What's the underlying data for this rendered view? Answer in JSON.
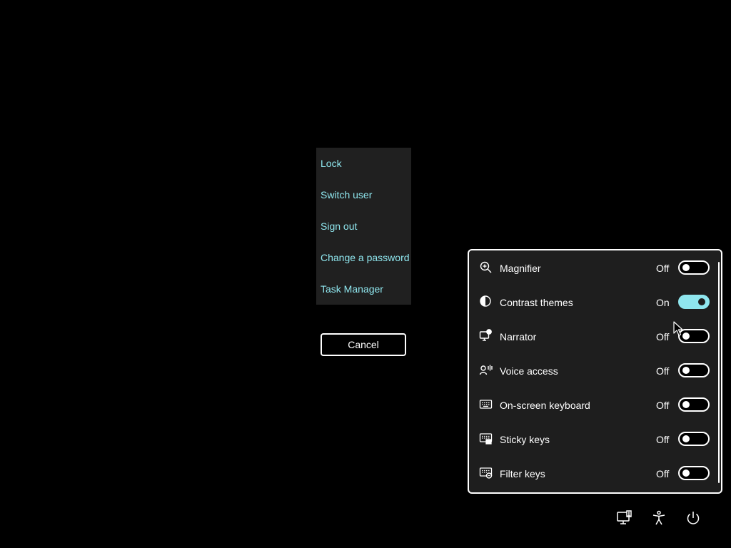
{
  "security_menu": {
    "items": [
      {
        "label": "Lock"
      },
      {
        "label": "Switch user"
      },
      {
        "label": "Sign out"
      },
      {
        "label": "Change a password"
      },
      {
        "label": "Task Manager"
      }
    ],
    "cancel_label": "Cancel"
  },
  "accessibility_panel": {
    "rows": [
      {
        "label": "Magnifier",
        "state": "Off",
        "on": false,
        "icon": "magnifier-icon"
      },
      {
        "label": "Contrast themes",
        "state": "On",
        "on": true,
        "icon": "contrast-icon"
      },
      {
        "label": "Narrator",
        "state": "Off",
        "on": false,
        "icon": "narrator-icon"
      },
      {
        "label": "Voice access",
        "state": "Off",
        "on": false,
        "icon": "voice-access-icon"
      },
      {
        "label": "On-screen keyboard",
        "state": "Off",
        "on": false,
        "icon": "keyboard-icon"
      },
      {
        "label": "Sticky keys",
        "state": "Off",
        "on": false,
        "icon": "sticky-keys-icon"
      },
      {
        "label": "Filter keys",
        "state": "Off",
        "on": false,
        "icon": "filter-keys-icon"
      }
    ]
  },
  "tray": {
    "icons": [
      "network-icon",
      "accessibility-icon",
      "power-icon"
    ]
  },
  "colors": {
    "background": "#000000",
    "accent": "#8fe6ee",
    "panel": "#1e1e1e",
    "menu": "#202020"
  }
}
